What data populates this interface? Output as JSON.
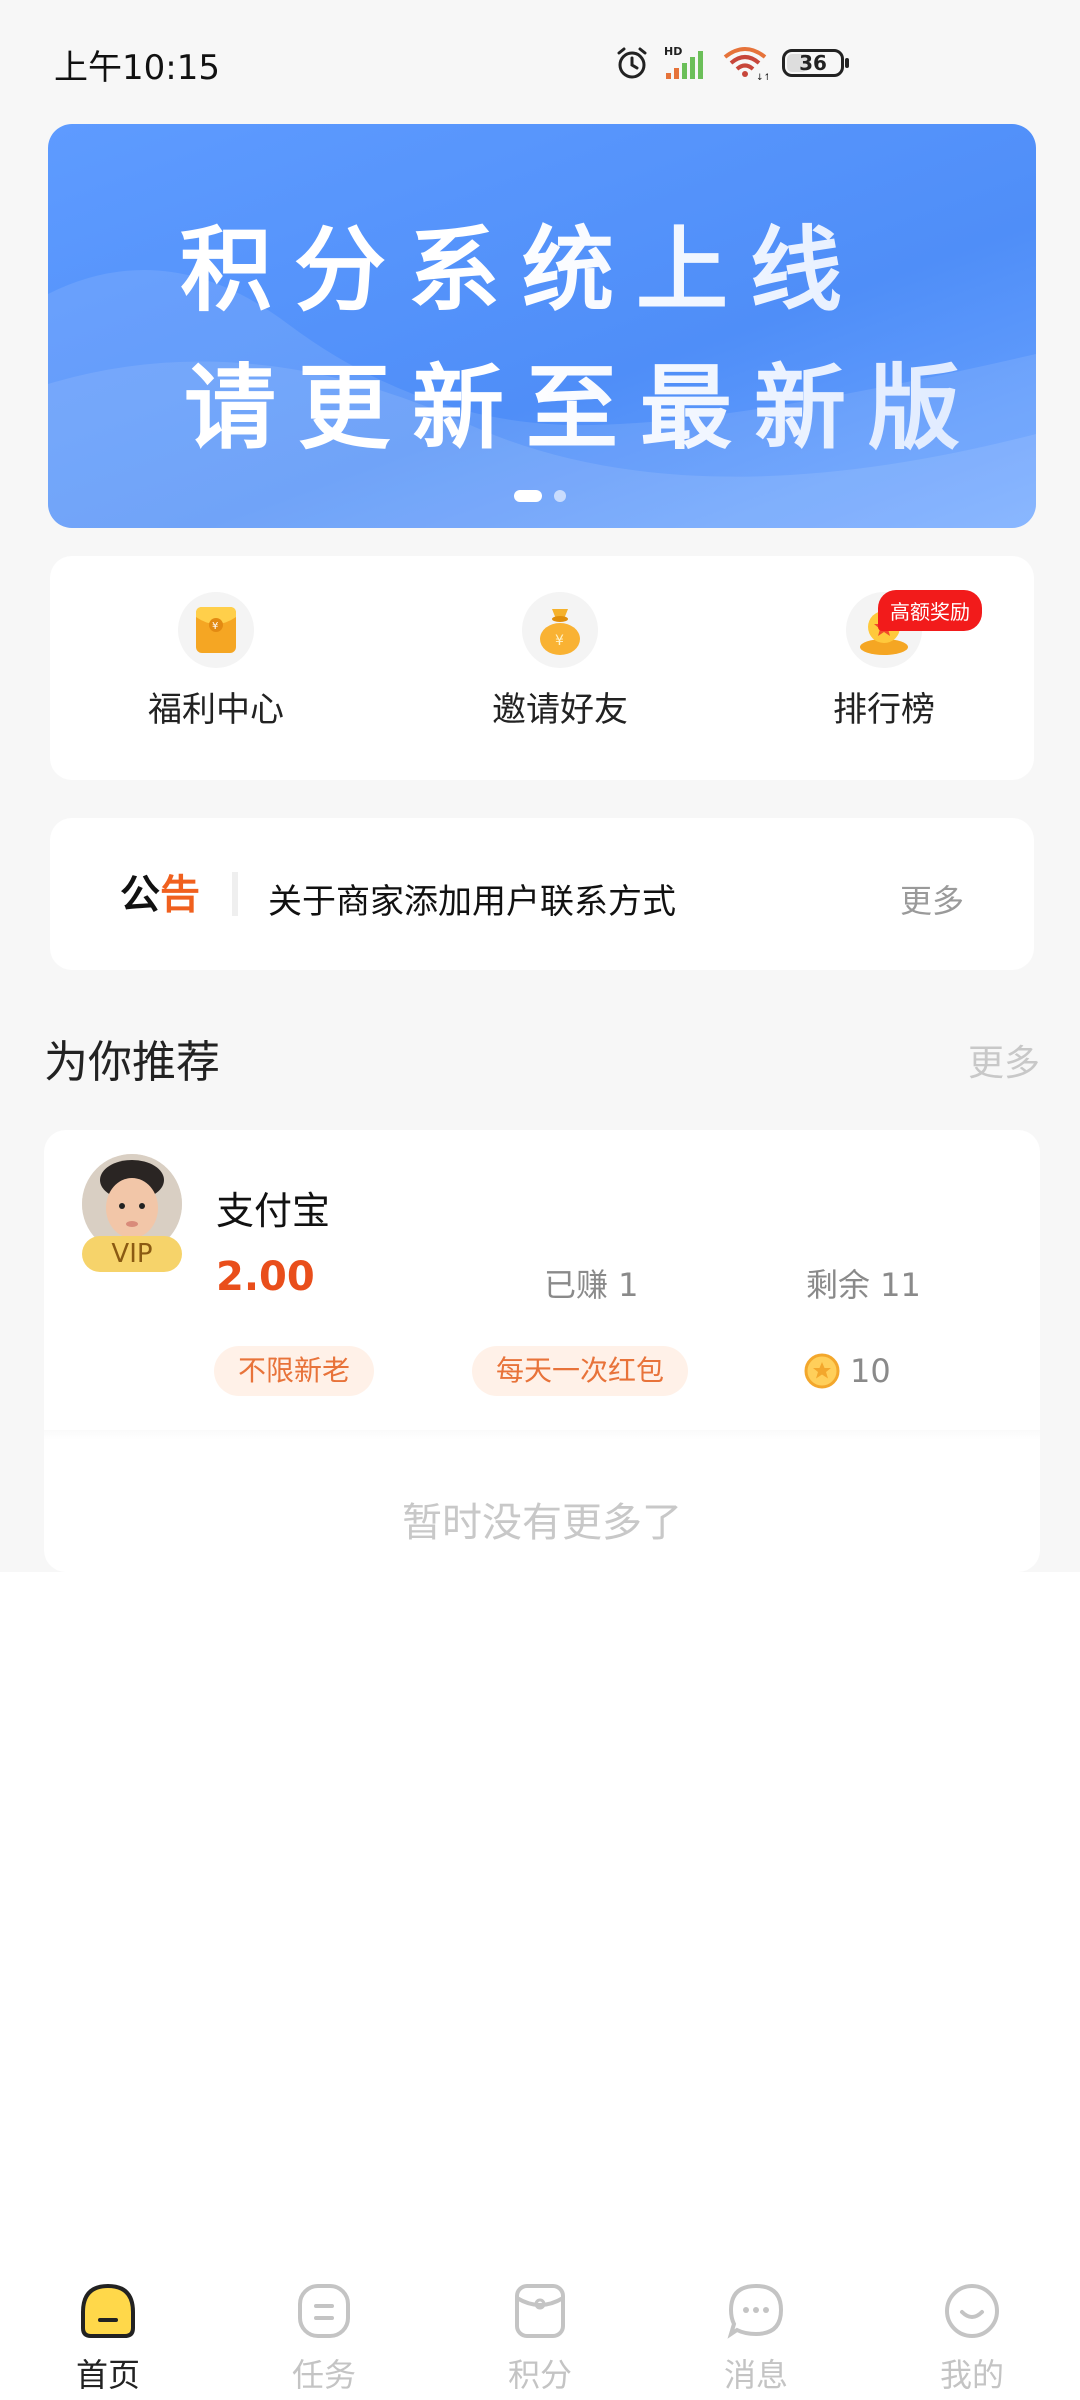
{
  "status_bar": {
    "time": "上午10:15",
    "battery": "36",
    "icons": [
      "alarm-icon",
      "hd-signal-icon",
      "wifi-icon",
      "battery-icon"
    ]
  },
  "banner": {
    "line1": "积分系统上线",
    "line2": "请更新至最新版",
    "page_count": 2,
    "active_page": 1,
    "colors": {
      "background": "#5e9bff"
    }
  },
  "quick_menu": {
    "items": [
      {
        "label": "福利中心",
        "icon": "red-envelope-icon"
      },
      {
        "label": "邀请好友",
        "icon": "money-bag-icon"
      },
      {
        "label": "排行榜",
        "icon": "medal-icon",
        "badge": "高额奖励"
      }
    ]
  },
  "notice": {
    "logo": "公告",
    "text": "关于商家添加用户联系方式",
    "more": "更多"
  },
  "recommend": {
    "title": "为你推荐",
    "more": "更多",
    "items": [
      {
        "name": "支付宝",
        "vip": "VIP",
        "price": "2.00",
        "earned": "已赚 1",
        "remaining": "剩余 11",
        "tags": [
          "不限新老",
          "每天一次红包"
        ],
        "coins": "10"
      }
    ],
    "no_more": "暂时没有更多了"
  },
  "bottom_nav": {
    "items": [
      {
        "label": "首页",
        "icon": "home-icon",
        "active": true
      },
      {
        "label": "任务",
        "icon": "task-icon",
        "active": false
      },
      {
        "label": "积分",
        "icon": "points-icon",
        "active": false
      },
      {
        "label": "消息",
        "icon": "message-icon",
        "active": false
      },
      {
        "label": "我的",
        "icon": "profile-icon",
        "active": false
      }
    ]
  },
  "colors": {
    "accent_price": "#e94e1b",
    "tag_bg": "#fff1e8",
    "tag_text": "#e8733a",
    "badge": "#f21b1b",
    "nav_active": "#ffd84a"
  }
}
